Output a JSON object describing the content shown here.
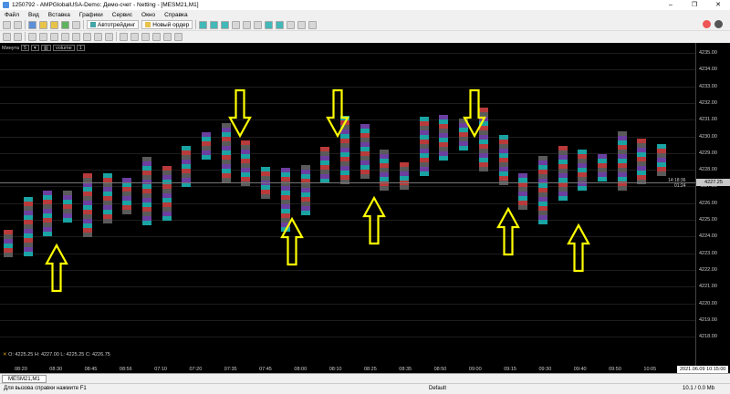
{
  "window": {
    "title": "1250792 - AMPGlobalUSA-Demo: Демо-счет - Netting - [MESM21,M1]",
    "minimize": "–",
    "maximize": "❐",
    "close": "✕"
  },
  "menu": [
    "Файл",
    "Вид",
    "Вставка",
    "Графики",
    "Сервис",
    "Окно",
    "Справка"
  ],
  "toolbar": {
    "algo_label": "Автотрейдинг",
    "new_order_label": "Новый ордер"
  },
  "chart_window": {
    "timeframe_label": "Минута",
    "timeframe_value": "5",
    "indicator_label": "volume",
    "indicator_value": "1",
    "ohlc": {
      "o_label": "O:",
      "o": "4225.25",
      "h_label": "H:",
      "h": "4227.00",
      "l_label": "L:",
      "l": "4225.25",
      "c_label": "C:",
      "c": "4226.75"
    },
    "current_price": "4227.25",
    "time_label": "14:18:36",
    "countdown": "01:24"
  },
  "price_axis": [
    "4235.00",
    "4234.00",
    "4233.00",
    "4232.00",
    "4231.00",
    "4230.00",
    "4229.00",
    "4228.00",
    "4227.00",
    "4226.00",
    "4225.00",
    "4224.00",
    "4223.00",
    "4222.00",
    "4221.00",
    "4220.00",
    "4219.00",
    "4218.00"
  ],
  "time_axis": [
    "08:20",
    "08:30",
    "08:45",
    "08:56",
    "07:10",
    "07:20",
    "07:35",
    "07:45",
    "08:00",
    "08:10",
    "08:25",
    "08:35",
    "08:50",
    "09:00",
    "09:15",
    "09:30",
    "09:40",
    "09:50",
    "10:05"
  ],
  "time_axis_current": "2021.06.09 10:15:00",
  "tabs": [
    {
      "label": "MESM21,M1"
    }
  ],
  "status": {
    "help": "Для вызова справки нажмите F1",
    "profile": "Default",
    "traffic": "10.1 / 0.0 Mb"
  },
  "colors": {
    "arrow": "#ffff00",
    "red": "#b83a3a",
    "teal": "#1aa3a3",
    "purple": "#6b3fa0",
    "grey": "#5a5a5a"
  }
}
